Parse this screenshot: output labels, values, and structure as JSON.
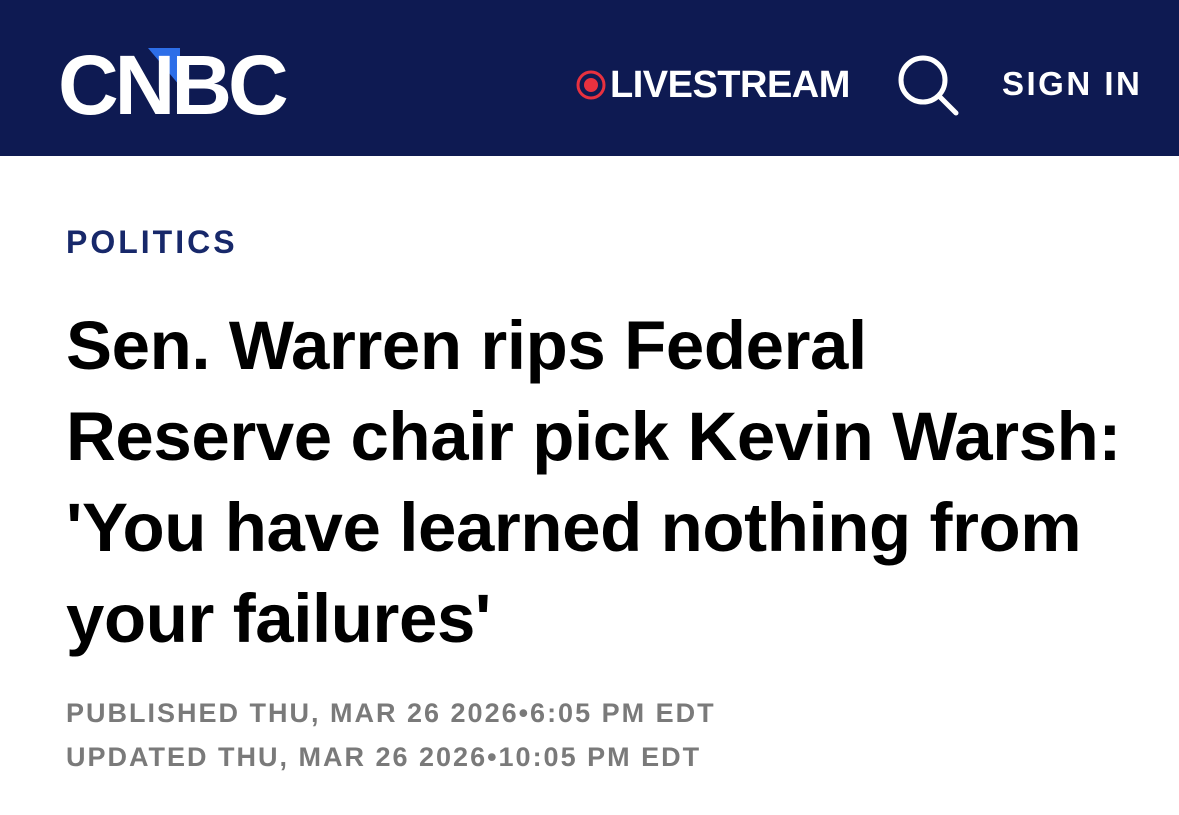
{
  "header": {
    "brand": "CNBC",
    "livestream_label": "LIVESTREAM",
    "search_icon": "search-icon",
    "sign_in_label": "SIGN IN",
    "background_color": "#0e1a52",
    "live_dot_color": "#e8313f"
  },
  "article": {
    "section": "POLITICS",
    "headline": "Sen. Warren rips Federal Reserve chair pick Kevin Warsh: 'You have learned nothing from your failures'",
    "published": "PUBLISHED THU, MAR 26 2026•6:05 PM EDT",
    "updated": "UPDATED THU, MAR 26 2026•10:05 PM EDT"
  }
}
